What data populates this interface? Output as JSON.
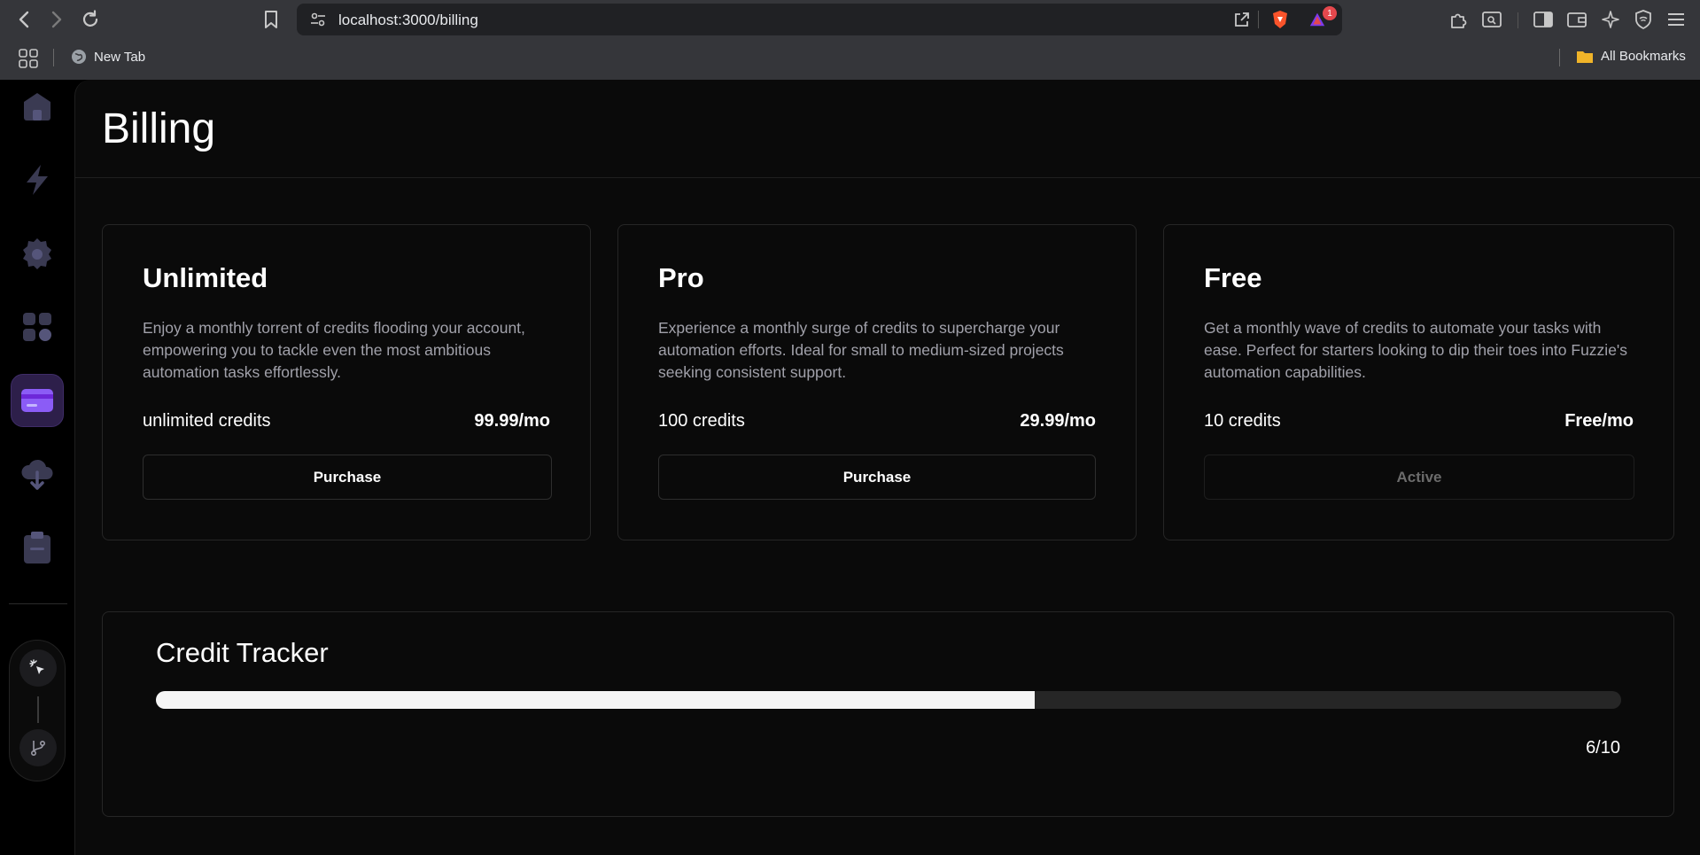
{
  "browser": {
    "url": "localhost:3000/billing",
    "bookmarks": {
      "new_tab": "New Tab",
      "all_bookmarks": "All Bookmarks"
    },
    "notification_count": "1"
  },
  "sidebar": {
    "items": [
      {
        "name": "home-icon"
      },
      {
        "name": "workflows-icon"
      },
      {
        "name": "settings-icon"
      },
      {
        "name": "connections-icon"
      },
      {
        "name": "billing-icon",
        "active": true
      },
      {
        "name": "cloud-download-icon"
      },
      {
        "name": "clipboard-icon"
      }
    ]
  },
  "page": {
    "title": "Billing"
  },
  "plans": [
    {
      "title": "Unlimited",
      "description": "Enjoy a monthly torrent of credits flooding your account, empowering you to tackle even the most ambitious automation tasks effortlessly.",
      "credits": "unlimited credits",
      "price": "99.99/mo",
      "button": "Purchase"
    },
    {
      "title": "Pro",
      "description": "Experience a monthly surge of credits to supercharge your automation efforts. Ideal for small to medium-sized projects seeking consistent support.",
      "credits": "100 credits",
      "price": "29.99/mo",
      "button": "Purchase"
    },
    {
      "title": "Free",
      "description": "Get a monthly wave of credits to automate your tasks with ease. Perfect for starters looking to dip their toes into Fuzzie's automation capabilities.",
      "credits": "10 credits",
      "price": "Free/mo",
      "button": "Active"
    }
  ],
  "tracker": {
    "title": "Credit Tracker",
    "used": 6,
    "total": 10,
    "count_label": "6/10"
  },
  "colors": {
    "accent": "#2d1f4a",
    "accent_icon": "#8b5cf6"
  }
}
